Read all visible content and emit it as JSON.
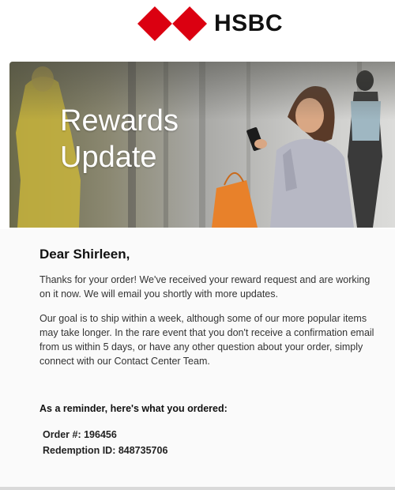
{
  "brand": {
    "name": "HSBC",
    "primary_color": "#db0011"
  },
  "hero": {
    "title_line1": "Rewards",
    "title_line2": "Update"
  },
  "email": {
    "greeting": "Dear Shirleen,",
    "paragraph1": "Thanks for your order! We've received your reward request and are working on it now. We will email you shortly with more updates.",
    "paragraph2": "Our goal is to ship within a week, although some of our more popular items may take longer. In the rare event that you don't receive a confirmation email from us within 5 days, or have any other question about your order, simply connect with our Contact Center Team.",
    "reminder": "As a reminder, here's what you ordered:",
    "order_number_line": "Order #: 196456",
    "redemption_id_line": "Redemption ID: 848735706"
  }
}
